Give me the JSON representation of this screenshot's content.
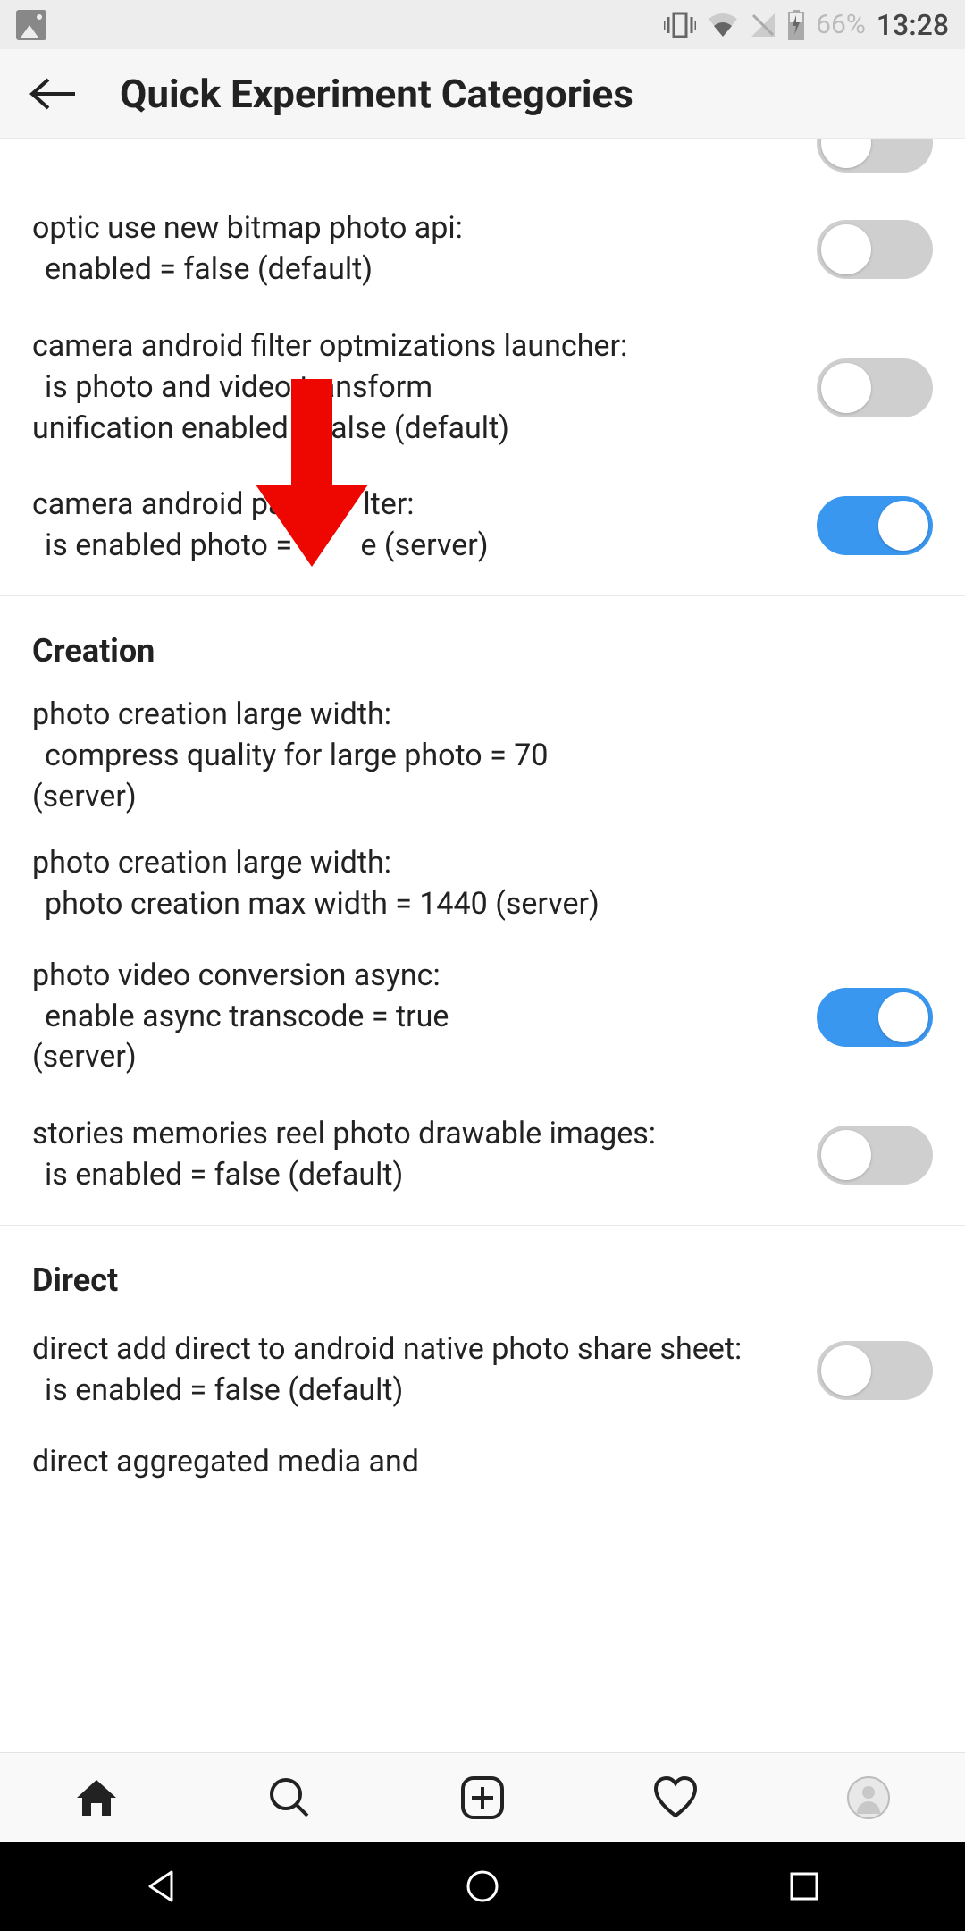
{
  "status": {
    "battery": "66%",
    "time": "13:28"
  },
  "header": {
    "title": "Quick Experiment Categories"
  },
  "sections": [
    {
      "rows": [
        {
          "title": "optic use new bitmap photo api:",
          "sub": "enabled = false (default)",
          "toggle": "off"
        },
        {
          "title": "camera android filter optmizations launcher:",
          "sub": "is photo and video transform unification enabled = false (default)",
          "toggle": "off",
          "wrap_sub": true
        },
        {
          "title": "camera android par    lter:",
          "sub": "is enabled photo =    e (server)",
          "toggle": "on"
        }
      ]
    },
    {
      "header": "Creation",
      "rows": [
        {
          "title": "photo creation large width:",
          "sub": "compress quality for large photo = 70 (server)",
          "info": true,
          "wrap_sub": true
        },
        {
          "title": "photo creation large width:",
          "sub": "photo creation max width = 1440 (server)",
          "info": true
        },
        {
          "title": "photo video conversion async:",
          "sub": "enable async transcode = true (server)",
          "toggle": "on",
          "wrap_sub": true
        },
        {
          "title": "stories memories reel photo drawable images:",
          "sub": "is enabled = false (default)",
          "toggle": "off"
        }
      ]
    },
    {
      "header": "Direct",
      "rows": [
        {
          "title": "direct add direct to android native photo share sheet:",
          "sub": "is enabled = false (default)",
          "toggle": "off"
        },
        {
          "title": "direct aggregated media and",
          "sub": "",
          "partial": true
        }
      ]
    }
  ],
  "colors": {
    "accent": "#3a97f0",
    "arrow": "#ee0600"
  }
}
